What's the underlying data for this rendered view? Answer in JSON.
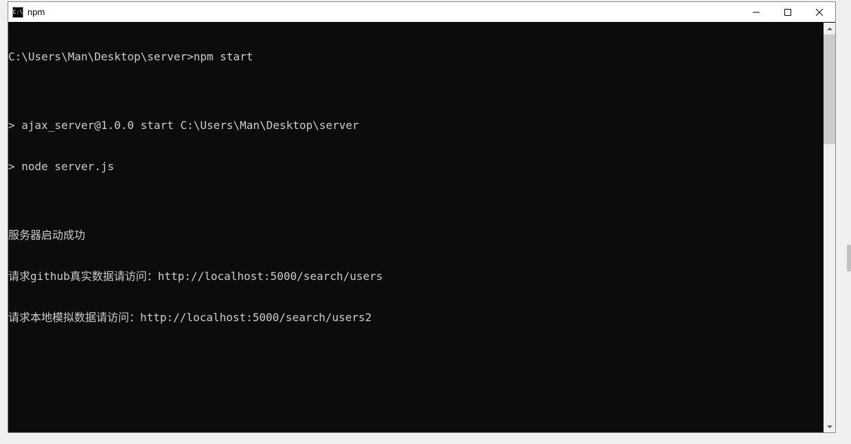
{
  "window": {
    "title": "npm",
    "icon_text": "C:\\"
  },
  "terminal": {
    "lines": [
      "C:\\Users\\Man\\Desktop\\server>npm start",
      "",
      "> ajax_server@1.0.0 start C:\\Users\\Man\\Desktop\\server",
      "> node server.js",
      "",
      "服务器启动成功",
      "请求github真实数据请访问：http://localhost:5000/search/users",
      "请求本地模拟数据请访问：http://localhost:5000/search/users2"
    ]
  }
}
